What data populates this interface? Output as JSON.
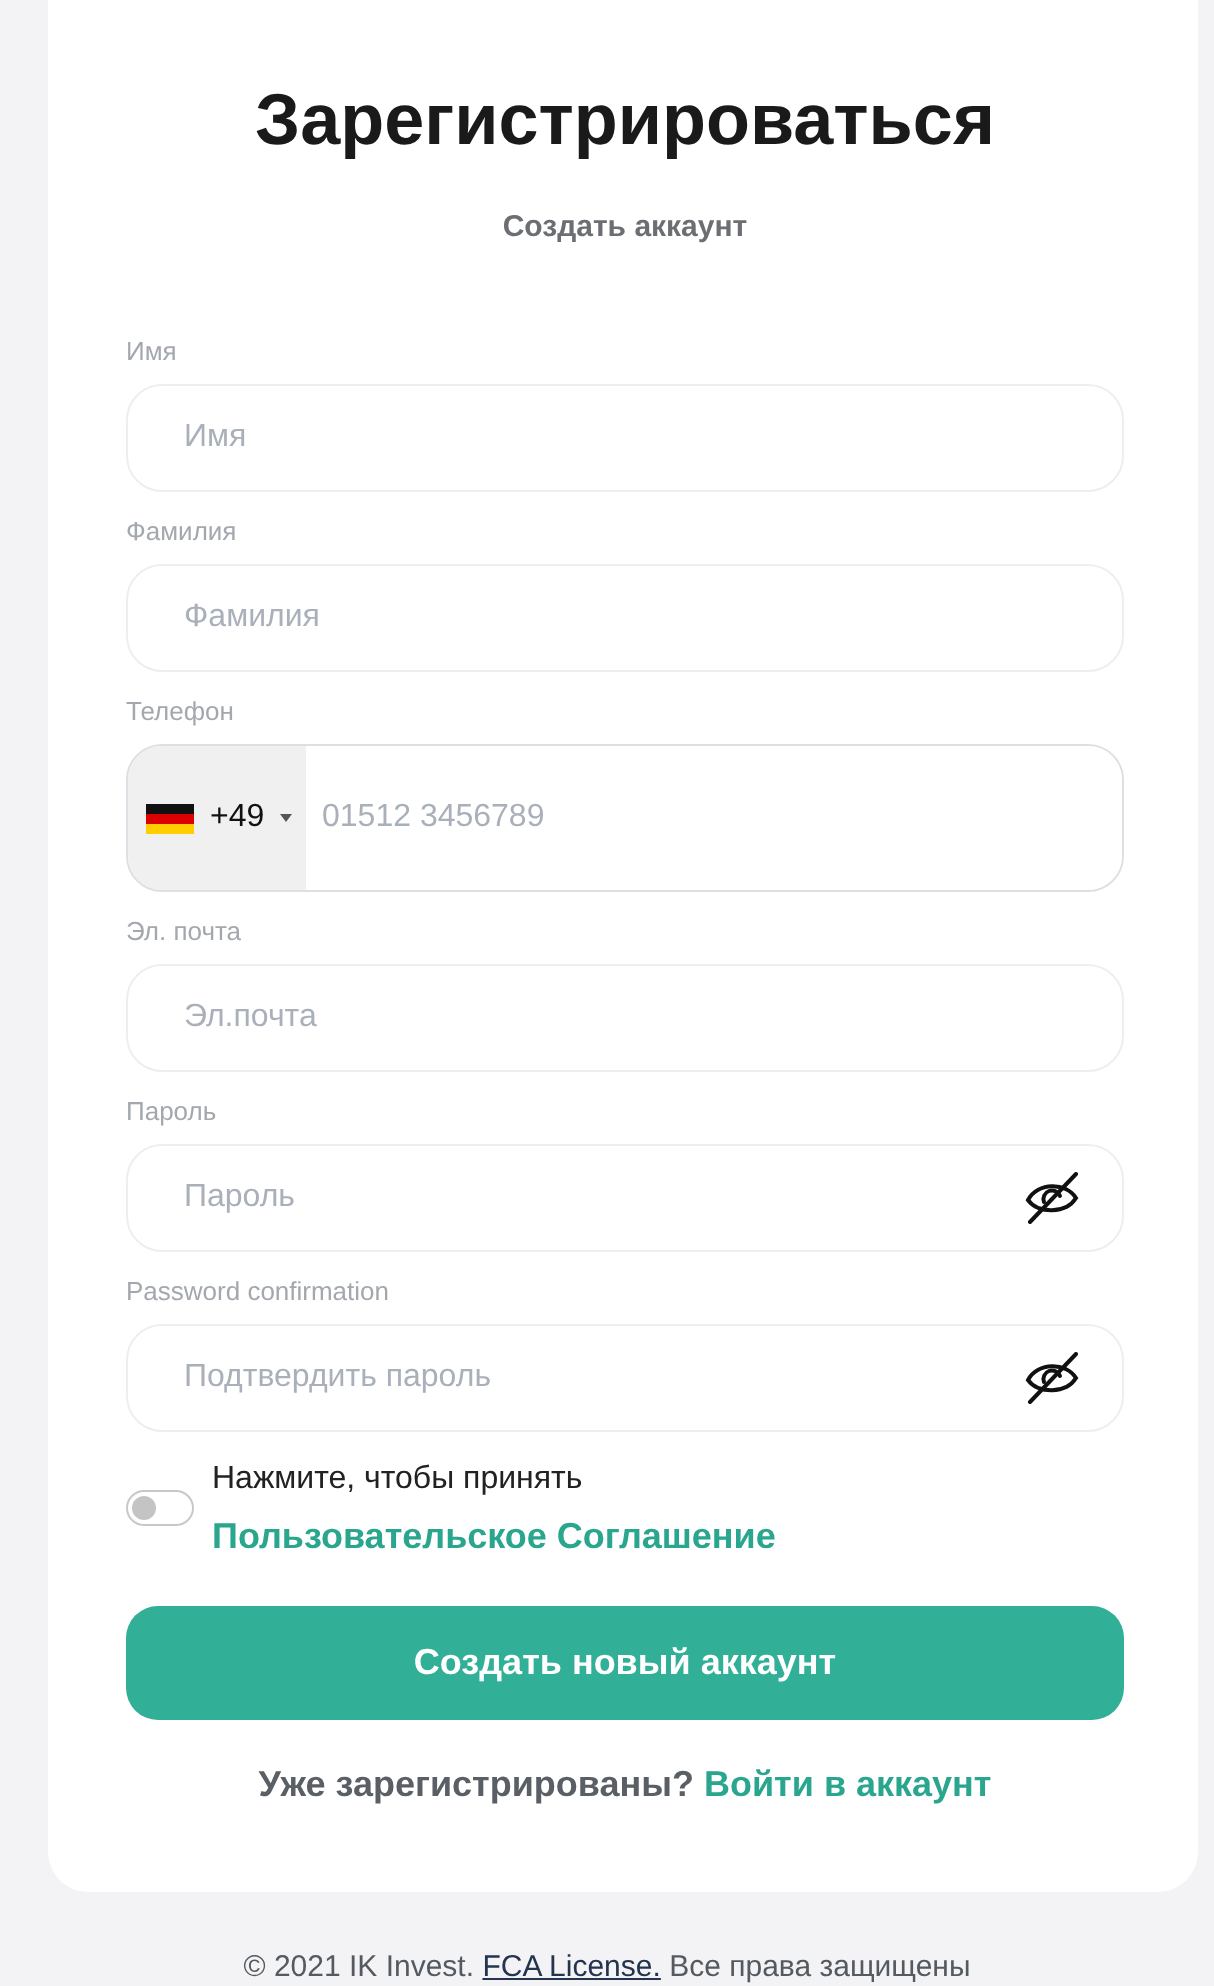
{
  "heading": {
    "title": "Зарегистрироваться",
    "subtitle": "Создать аккаунт"
  },
  "fields": [
    {
      "kind": "text",
      "label": "Имя",
      "placeholder": "Имя"
    },
    {
      "kind": "text",
      "label": "Фамилия",
      "placeholder": "Фамилия"
    },
    {
      "kind": "phone",
      "label": "Телефон",
      "dial_code": "+49",
      "placeholder": "01512 3456789"
    },
    {
      "kind": "text",
      "label": "Эл. почта",
      "placeholder": "Эл.почта"
    },
    {
      "kind": "password",
      "label": "Пароль",
      "placeholder": "Пароль"
    },
    {
      "kind": "password",
      "label": "Password confirmation",
      "placeholder": "Подтвердить пароль"
    }
  ],
  "agreement": {
    "on": false,
    "text": "Нажмите, чтобы принять",
    "link": "Пользовательское Соглашение"
  },
  "submit_button": "Создать новый аккаунт",
  "login_prompt": {
    "text": "Уже зарегистрированы?",
    "link": "Войти в аккаунт"
  },
  "footer": {
    "copyright": "© 2021 IK Invest.",
    "license_link": "FCA License.",
    "rights": "Все права защищены"
  }
}
